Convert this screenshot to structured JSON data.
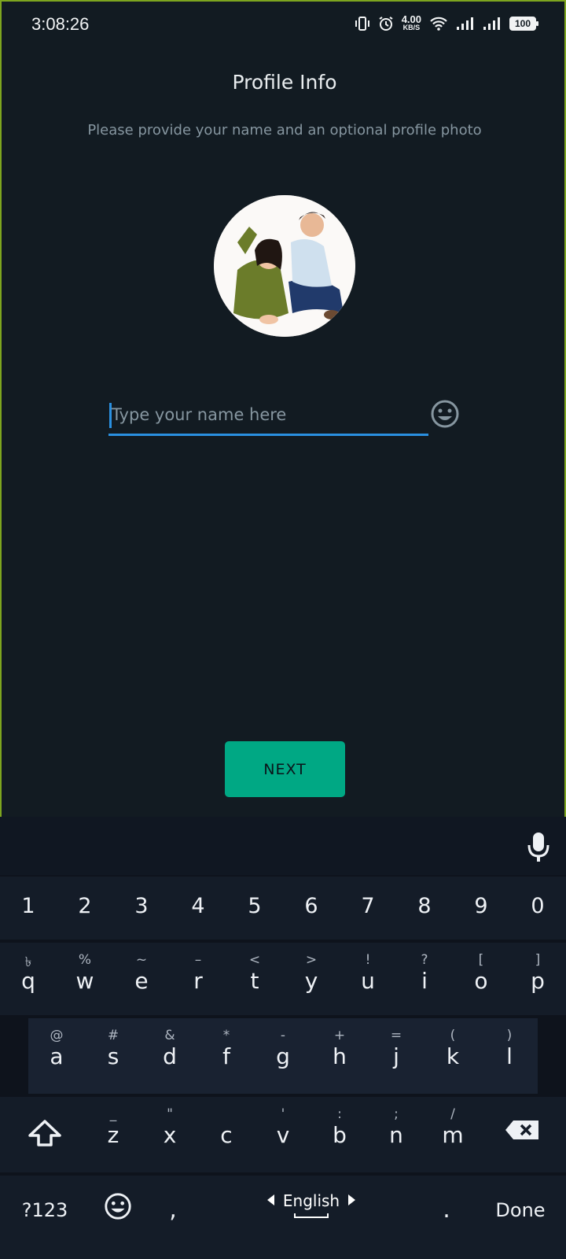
{
  "status_bar": {
    "time": "3:08:26",
    "speed_value": "4.00",
    "speed_unit": "KB/S",
    "battery": "100"
  },
  "screen": {
    "title": "Profile Info",
    "subtitle": "Please provide your name and an optional profile photo",
    "name_placeholder": "Type your name here",
    "next_label": "NEXT"
  },
  "keyboard": {
    "numbers": [
      "1",
      "2",
      "3",
      "4",
      "5",
      "6",
      "7",
      "8",
      "9",
      "0"
    ],
    "row_q": [
      {
        "key": "q",
        "alt": "৳"
      },
      {
        "key": "w",
        "alt": "%"
      },
      {
        "key": "e",
        "alt": "~"
      },
      {
        "key": "r",
        "alt": "–"
      },
      {
        "key": "t",
        "alt": "<"
      },
      {
        "key": "y",
        "alt": ">"
      },
      {
        "key": "u",
        "alt": "!"
      },
      {
        "key": "i",
        "alt": "?"
      },
      {
        "key": "o",
        "alt": "["
      },
      {
        "key": "p",
        "alt": "]"
      }
    ],
    "row_a": [
      {
        "key": "a",
        "alt": "@"
      },
      {
        "key": "s",
        "alt": "#"
      },
      {
        "key": "d",
        "alt": "&"
      },
      {
        "key": "f",
        "alt": "*"
      },
      {
        "key": "g",
        "alt": "-"
      },
      {
        "key": "h",
        "alt": "+"
      },
      {
        "key": "j",
        "alt": "="
      },
      {
        "key": "k",
        "alt": "("
      },
      {
        "key": "l",
        "alt": ")"
      }
    ],
    "row_z": [
      {
        "key": "z",
        "alt": "_"
      },
      {
        "key": "x",
        "alt": "\""
      },
      {
        "key": "c",
        "alt": ""
      },
      {
        "key": "v",
        "alt": "'"
      },
      {
        "key": "b",
        "alt": ":"
      },
      {
        "key": "n",
        "alt": ";"
      },
      {
        "key": "m",
        "alt": "/"
      }
    ],
    "symbols_label": "?123",
    "comma": ",",
    "period": ".",
    "language": "English",
    "done_label": "Done"
  },
  "colors": {
    "accent": "#00a884",
    "input_underline": "#2a90e0",
    "background": "#121b22"
  }
}
